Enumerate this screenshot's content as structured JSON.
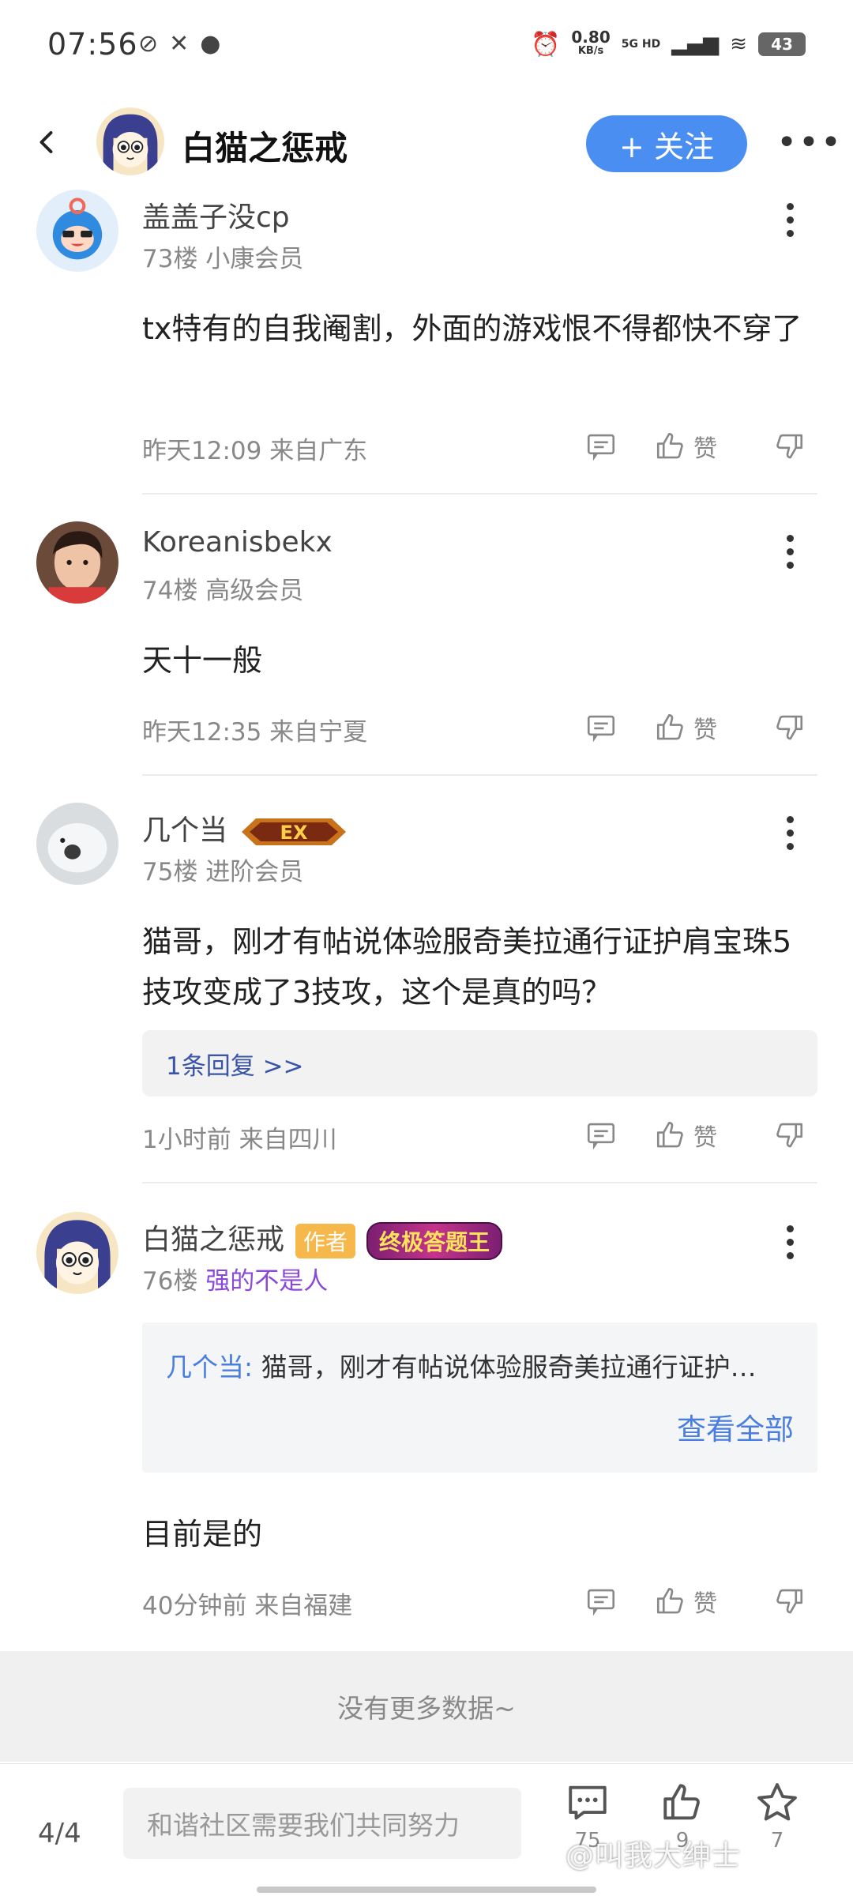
{
  "status_bar": {
    "time": "07:56",
    "net_speed": "0.80",
    "net_unit": "KB/s",
    "net_type": "5G HD",
    "battery": "43"
  },
  "header": {
    "title": "白猫之惩戒",
    "follow_label": "+ 关注"
  },
  "comments": [
    {
      "name": "盖盖子没cp",
      "floor_level": "73楼 小康会员",
      "text": "tx特有的自我阉割，外面的游戏恨不得都快不穿了",
      "time_location": "昨天12:09 来自广东",
      "like_label": "赞"
    },
    {
      "name": "Koreanisbekx",
      "floor_level": "74楼 高级会员",
      "text": "天十一般",
      "time_location": "昨天12:35 来自宁夏",
      "like_label": "赞"
    },
    {
      "name": "几个当",
      "badge": "EX",
      "floor_level": "75楼 进阶会员",
      "text": "猫哥，刚才有帖说体验服奇美拉通行证护肩宝珠5技攻变成了3技攻，这个是真的吗？",
      "replies_link": "1条回复 >>",
      "time_location": "1小时前 来自四川",
      "like_label": "赞"
    },
    {
      "name": "白猫之惩戒",
      "author_tag": "作者",
      "title_badge": "终极答题王",
      "floor": "76楼",
      "level": "强的不是人",
      "quote_name": "几个当:",
      "quote_text": "猫哥，刚才有帖说体验服奇美拉通行证护…",
      "quote_more": "查看全部",
      "text": "目前是的",
      "time_location": "40分钟前 来自福建",
      "like_label": "赞"
    }
  ],
  "no_more": "没有更多数据~",
  "bottom_bar": {
    "page": "4/4",
    "input_placeholder": "和谐社区需要我们共同努力",
    "comment_count": "75",
    "like_count": "9",
    "star_count": "7"
  },
  "watermark": "@叫我大绅士",
  "colors": {
    "accent_blue": "#4b8ef1",
    "author_tag": "#f6b84a",
    "level_purple": "#8a49d8"
  }
}
